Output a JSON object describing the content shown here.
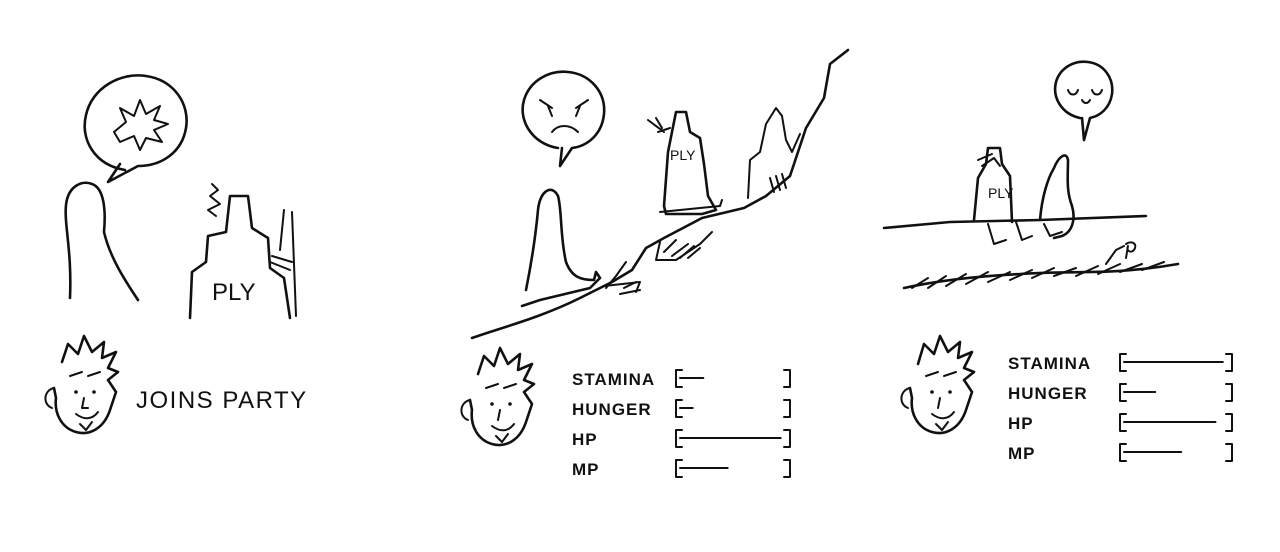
{
  "panel1": {
    "sign_text": "PLY",
    "caption": "JOINS PARTY"
  },
  "panel2": {
    "sign_text": "PLY",
    "stats": [
      {
        "label": "STAMINA",
        "level": 0.22
      },
      {
        "label": "HUNGER",
        "level": 0.12
      },
      {
        "label": "HP",
        "level": 0.95
      },
      {
        "label": "MP",
        "level": 0.45
      }
    ]
  },
  "panel3": {
    "sign_text": "PLY",
    "stats": [
      {
        "label": "STAMINA",
        "level": 0.95
      },
      {
        "label": "HUNGER",
        "level": 0.3
      },
      {
        "label": "HP",
        "level": 0.88
      },
      {
        "label": "MP",
        "level": 0.55
      }
    ]
  }
}
